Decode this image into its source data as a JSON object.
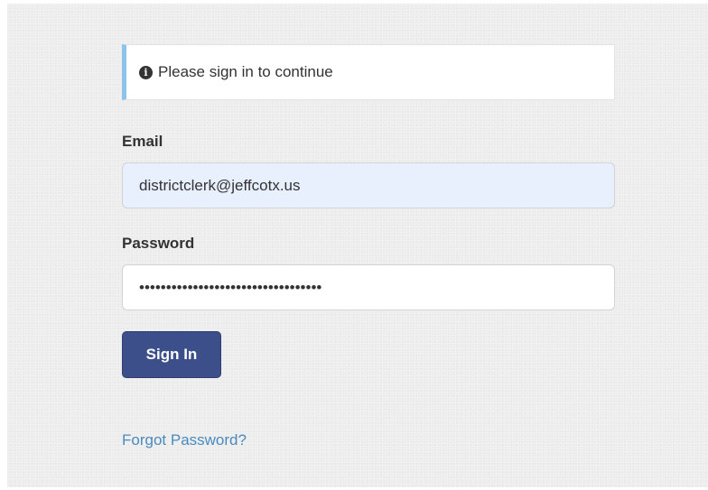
{
  "alert": {
    "icon": "info-circle-icon",
    "icon_glyph": "i",
    "message": "Please sign in to continue"
  },
  "form": {
    "email_label": "Email",
    "email_value": "districtclerk@jeffcotx.us",
    "password_label": "Password",
    "password_value": "••••••••••••••••••••••••••••••••••",
    "submit_label": "Sign In",
    "forgot_link": "Forgot Password?"
  },
  "colors": {
    "alert_accent": "#8cc3ea",
    "button_bg": "#3d4f8a",
    "link": "#4a8bbf",
    "autofill_bg": "#e8f0fe"
  }
}
